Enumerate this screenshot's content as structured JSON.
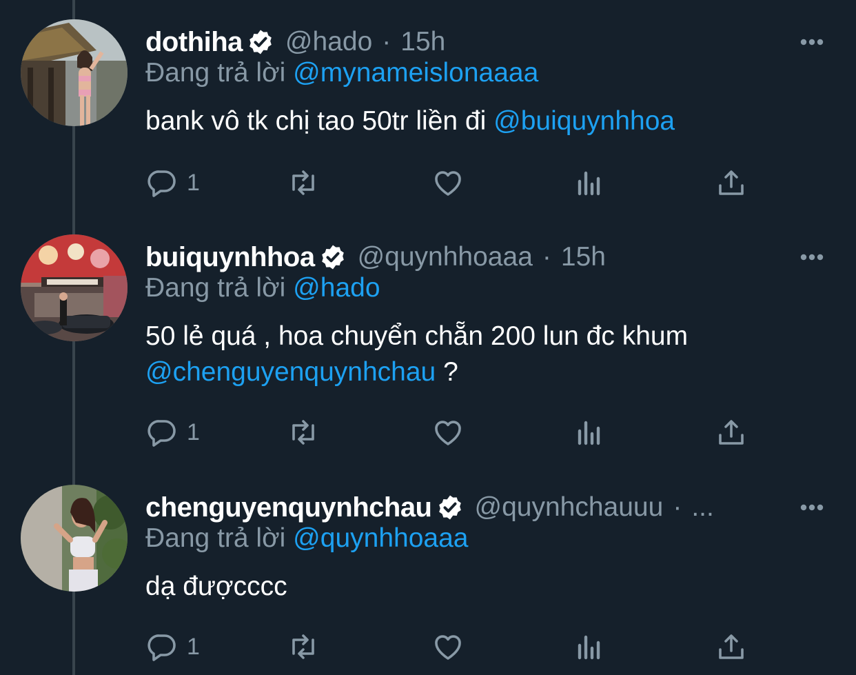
{
  "colors": {
    "background": "#15202b",
    "primary_text": "#ffffff",
    "secondary_text": "#8899a6",
    "accent": "#1da1f2",
    "thread_line": "#38444d"
  },
  "reply_prefix": "Đang trả lời",
  "tweets": [
    {
      "display_name": "dothiha",
      "handle": "@hado",
      "separator": "·",
      "time": "15h",
      "replying_to": "@mynameislonaaaa",
      "text_parts": [
        "bank vô tk chị tao 50tr liền đi ",
        "@buiquynhhoa"
      ],
      "reply_count": "1",
      "icons": [
        "verified-icon",
        "more-icon",
        "reply-icon",
        "retweet-icon",
        "like-icon",
        "analytics-icon",
        "share-icon"
      ]
    },
    {
      "display_name": "buiquynhhoa",
      "handle": "@quynhhoaaa",
      "separator": "·",
      "time": "15h",
      "replying_to": "@hado",
      "text_parts": [
        "50 lẻ quá , hoa chuyển chẵn 200 lun đc khum ",
        "@chenguyenquynhchau",
        " ?"
      ],
      "reply_count": "1",
      "icons": [
        "verified-icon",
        "more-icon",
        "reply-icon",
        "retweet-icon",
        "like-icon",
        "analytics-icon",
        "share-icon"
      ]
    },
    {
      "display_name": "chenguyenquynhchau",
      "handle": "@quynhchauuu",
      "separator": "·",
      "time": "...",
      "replying_to": "@quynhhoaaa",
      "text_parts": [
        "dạ đượcccc"
      ],
      "reply_count": "1",
      "icons": [
        "verified-icon",
        "more-icon",
        "reply-icon",
        "retweet-icon",
        "like-icon",
        "analytics-icon",
        "share-icon"
      ]
    }
  ]
}
